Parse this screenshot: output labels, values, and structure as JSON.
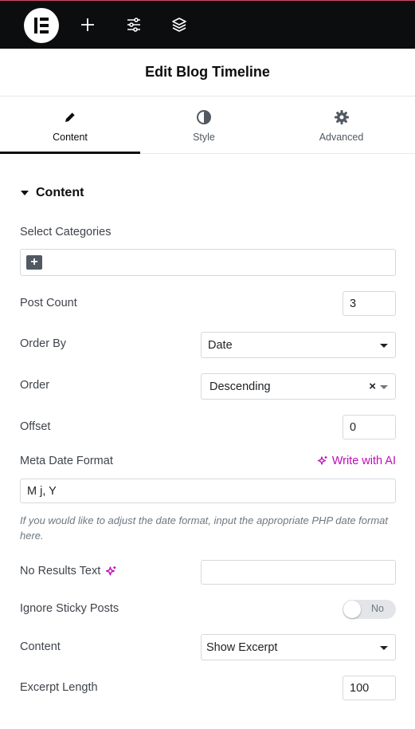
{
  "topbar": {
    "icons": [
      "elementor-logo-icon",
      "plus-icon",
      "sliders-icon",
      "layers-icon"
    ]
  },
  "panel": {
    "title": "Edit Blog Timeline"
  },
  "tabs": [
    {
      "label": "Content",
      "icon": "pencil-icon",
      "active": true
    },
    {
      "label": "Style",
      "icon": "half-circle-icon",
      "active": false
    },
    {
      "label": "Advanced",
      "icon": "gear-icon",
      "active": false
    }
  ],
  "section": {
    "title": "Content"
  },
  "fields": {
    "categories": {
      "label": "Select Categories",
      "add_symbol": "+"
    },
    "post_count": {
      "label": "Post Count",
      "value": "3"
    },
    "order_by": {
      "label": "Order By",
      "value": "Date"
    },
    "order": {
      "label": "Order",
      "value": "Descending",
      "clear_symbol": "×"
    },
    "offset": {
      "label": "Offset",
      "value": "0"
    },
    "meta_date_format": {
      "label": "Meta Date Format",
      "value": "M j, Y",
      "ai_link": "Write with AI",
      "hint": "If you would like to adjust the date format, input the appropriate PHP date format here."
    },
    "no_results": {
      "label": "No Results Text",
      "value": ""
    },
    "ignore_sticky": {
      "label": "Ignore Sticky Posts",
      "toggle_text": "No",
      "enabled": false
    },
    "content": {
      "label": "Content",
      "value": "Show Excerpt"
    },
    "excerpt_length": {
      "label": "Excerpt Length",
      "value": "100"
    }
  },
  "colors": {
    "topbar_bg": "#0c0d0e",
    "ai_accent": "#c00bb9",
    "active_tab_border": "#0c0d0e"
  }
}
